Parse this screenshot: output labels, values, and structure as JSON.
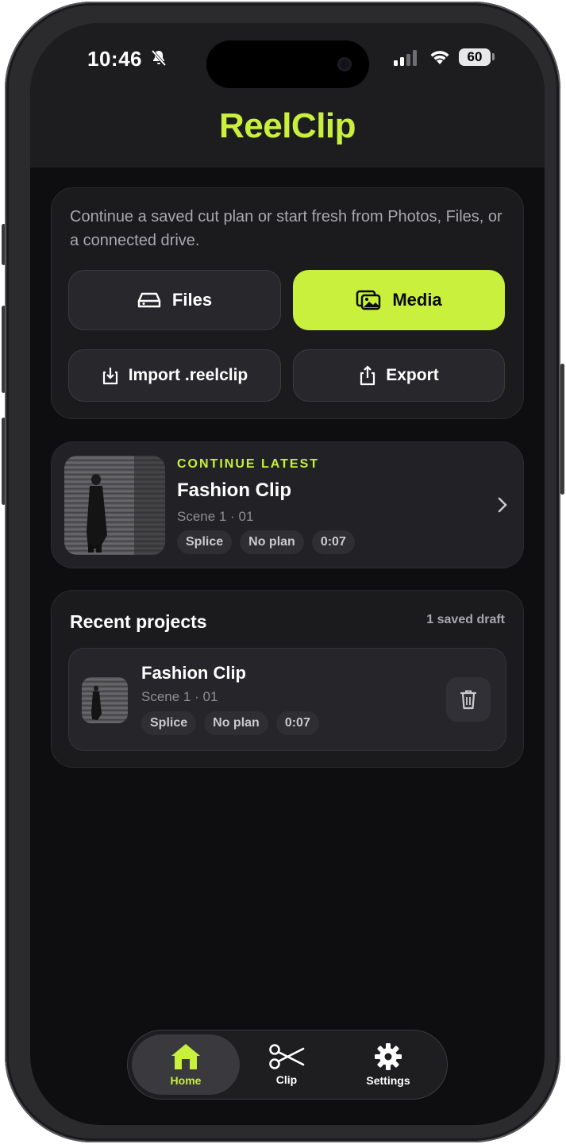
{
  "status_bar": {
    "time": "10:46",
    "battery": "60"
  },
  "app": {
    "name": "ReelClip",
    "name_rest": "eelClip",
    "name_first": "R"
  },
  "intro": {
    "text": "Continue a saved cut plan or start fresh from Photos, Files, or a connected drive.",
    "files_label": "Files",
    "media_label": "Media",
    "import_label": "Import .reelclip",
    "export_label": "Export"
  },
  "continue_latest": {
    "kicker": "CONTINUE LATEST",
    "title": "Fashion Clip",
    "subtitle": "Scene 1 · 01",
    "tags": [
      "Splice",
      "No plan",
      "0:07"
    ]
  },
  "recent": {
    "title": "Recent projects",
    "meta": "1 saved draft",
    "items": [
      {
        "title": "Fashion Clip",
        "subtitle": "Scene 1 · 01",
        "tags": [
          "Splice",
          "No plan",
          "0:07"
        ]
      }
    ]
  },
  "tabbar": {
    "tabs": [
      {
        "label": "Home",
        "icon": "home-icon",
        "active": true
      },
      {
        "label": "Clip",
        "icon": "scissors-icon",
        "active": false
      },
      {
        "label": "Settings",
        "icon": "gear-icon",
        "active": false
      }
    ]
  },
  "colors": {
    "accent": "#c8f03c",
    "background": "#0e0e10",
    "card": "#1b1b1e"
  }
}
